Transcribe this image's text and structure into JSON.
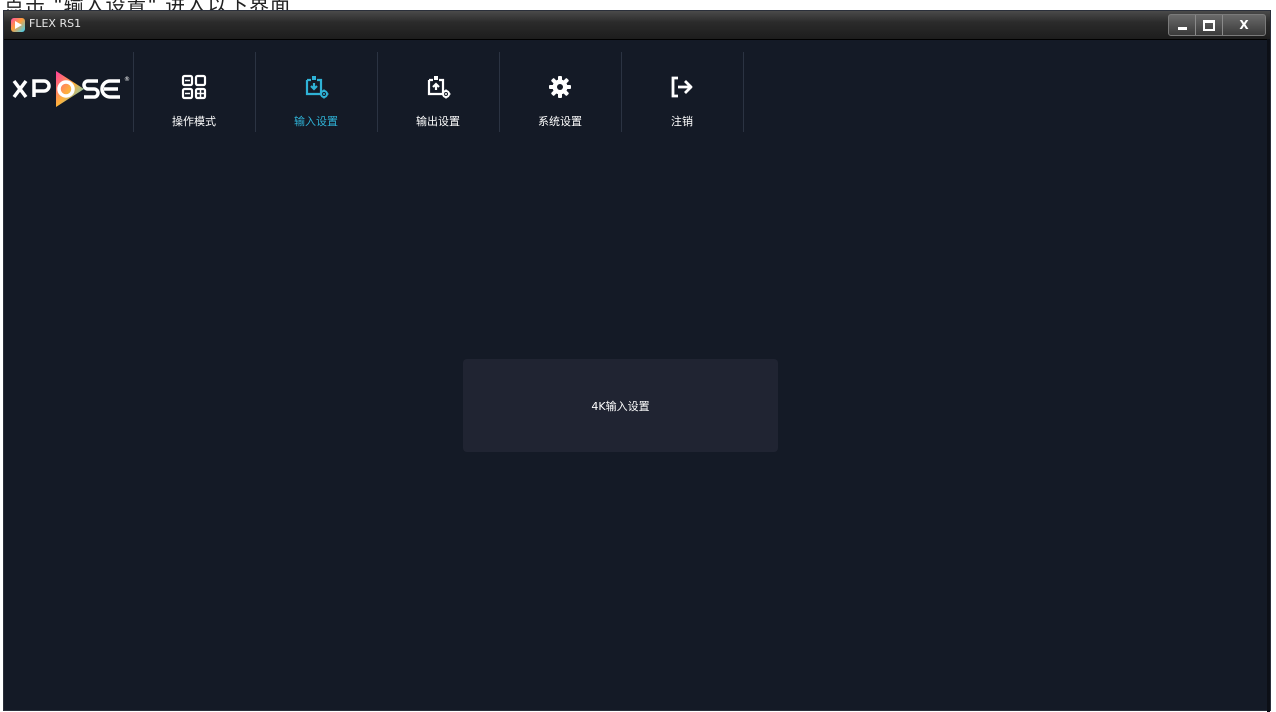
{
  "caption": {
    "text": "点击 \"输入设置\" 进入以下界面"
  },
  "window": {
    "title": "FLEX RS1",
    "controls": {
      "minimize": "minimize-icon",
      "maximize": "maximize-icon",
      "close_label": "X"
    }
  },
  "logo": {
    "text": "XPOSE",
    "registered": "®"
  },
  "nav": {
    "items": [
      {
        "label": "操作模式",
        "icon": "operation-mode-icon",
        "active": false
      },
      {
        "label": "输入设置",
        "icon": "input-settings-icon",
        "active": true
      },
      {
        "label": "输出设置",
        "icon": "output-settings-icon",
        "active": false
      },
      {
        "label": "系统设置",
        "icon": "gear-icon",
        "active": false
      },
      {
        "label": "注销",
        "icon": "logout-icon",
        "active": false
      }
    ]
  },
  "main": {
    "panel_label": "4K输入设置"
  },
  "colors": {
    "background": "#141a26",
    "active": "#2fb2d6",
    "panel": "#202432"
  }
}
